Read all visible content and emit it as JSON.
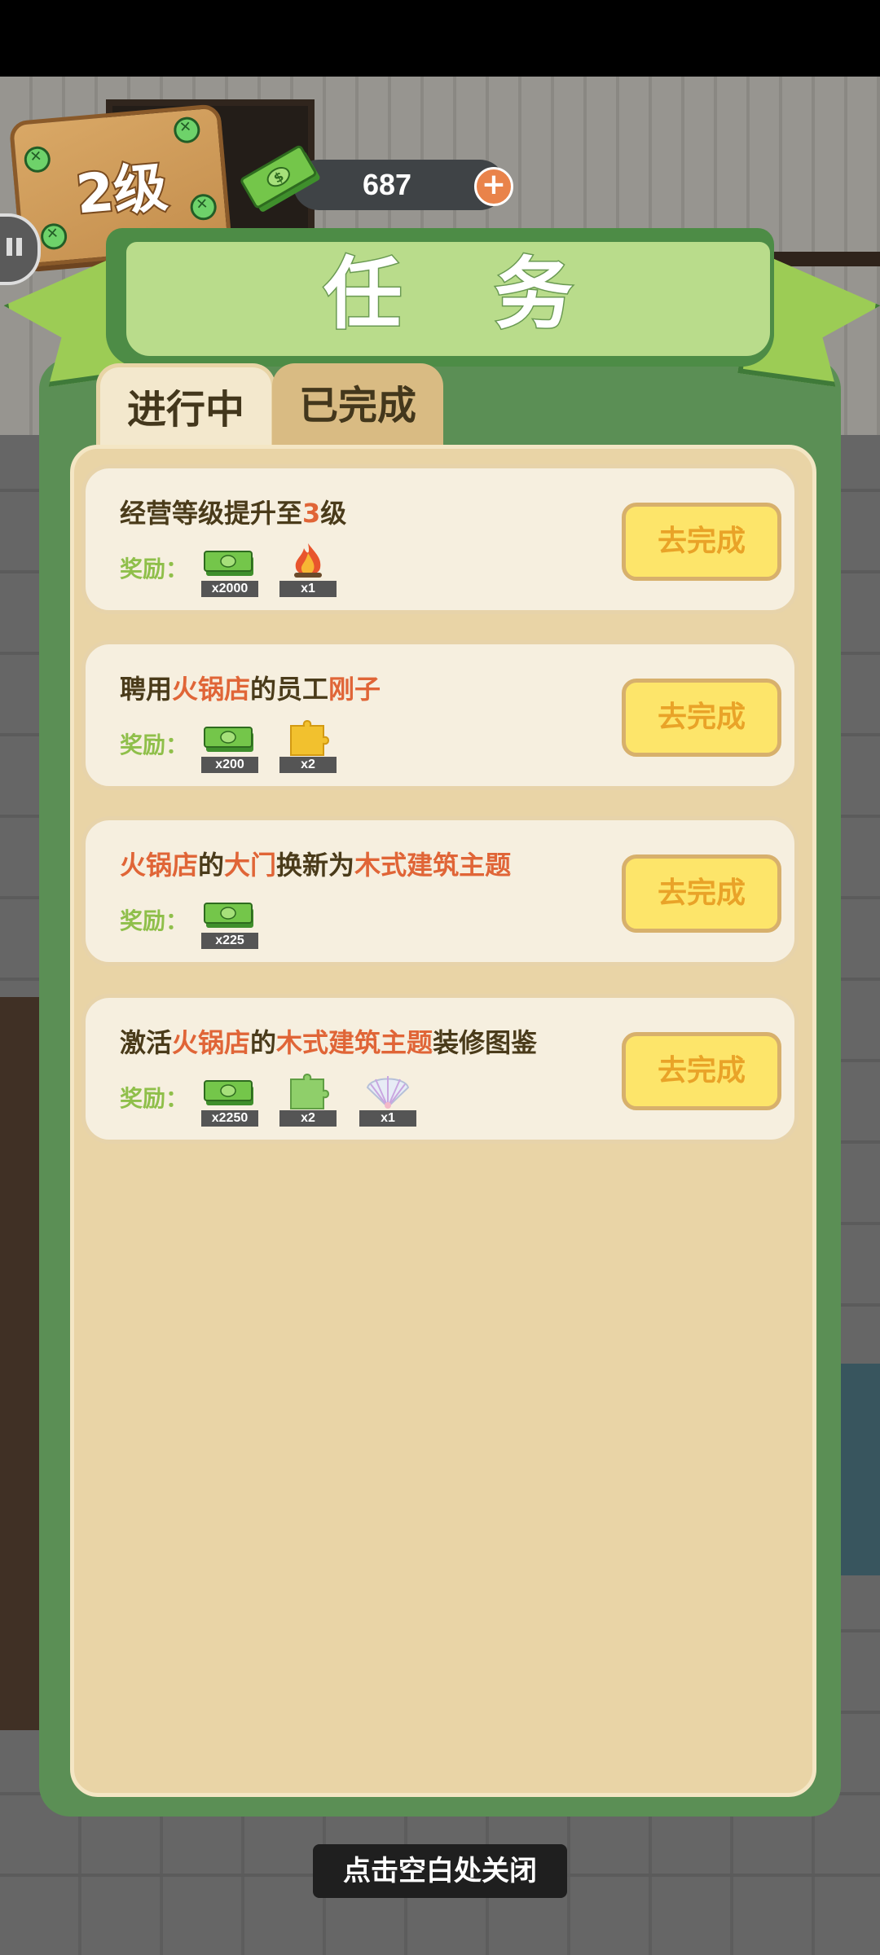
{
  "header": {
    "level_label": "2级",
    "coins": "687",
    "plus_label": "+"
  },
  "panel": {
    "title": "任 务",
    "tabs": [
      {
        "label": "进行中",
        "active": true
      },
      {
        "label": "已完成",
        "active": false
      }
    ]
  },
  "tasks": [
    {
      "title_parts": [
        {
          "text": "经营等级提升至",
          "hl": false
        },
        {
          "text": "3",
          "hl": true
        },
        {
          "text": "级",
          "hl": false
        }
      ],
      "reward_label": "奖励：",
      "rewards": [
        {
          "icon": "money-icon",
          "qty": "x2000"
        },
        {
          "icon": "fire-icon",
          "qty": "x1"
        }
      ],
      "button": "去完成"
    },
    {
      "title_parts": [
        {
          "text": "聘用",
          "hl": false
        },
        {
          "text": "火锅店",
          "hl": true
        },
        {
          "text": "的员工",
          "hl": false
        },
        {
          "text": "刚子",
          "hl": true
        }
      ],
      "reward_label": "奖励：",
      "rewards": [
        {
          "icon": "money-icon",
          "qty": "x200"
        },
        {
          "icon": "yellow-puzzle-icon",
          "qty": "x2"
        }
      ],
      "button": "去完成"
    },
    {
      "title_parts": [
        {
          "text": "火锅店",
          "hl": true
        },
        {
          "text": "的",
          "hl": false
        },
        {
          "text": "大门",
          "hl": true
        },
        {
          "text": "换新为",
          "hl": false
        },
        {
          "text": "木式建筑主题",
          "hl": true
        }
      ],
      "reward_label": "奖励：",
      "rewards": [
        {
          "icon": "money-icon",
          "qty": "x225"
        }
      ],
      "button": "去完成"
    },
    {
      "title_parts": [
        {
          "text": "激活",
          "hl": false
        },
        {
          "text": "火锅店",
          "hl": true
        },
        {
          "text": "的",
          "hl": false
        },
        {
          "text": "木式建筑主题",
          "hl": true
        },
        {
          "text": "装修图鉴",
          "hl": false
        }
      ],
      "reward_label": "奖励：",
      "rewards": [
        {
          "icon": "money-icon",
          "qty": "x2250"
        },
        {
          "icon": "green-puzzle-icon",
          "qty": "x2"
        },
        {
          "icon": "shell-icon",
          "qty": "x1"
        }
      ],
      "button": "去完成"
    }
  ],
  "close_hint": "点击空白处关闭",
  "colors": {
    "panel_green": "#5b8f55",
    "banner_green": "#b9dc8b",
    "highlight": "#e06537",
    "button_yellow": "#fde56a",
    "reward_label": "#8fbf4a"
  }
}
